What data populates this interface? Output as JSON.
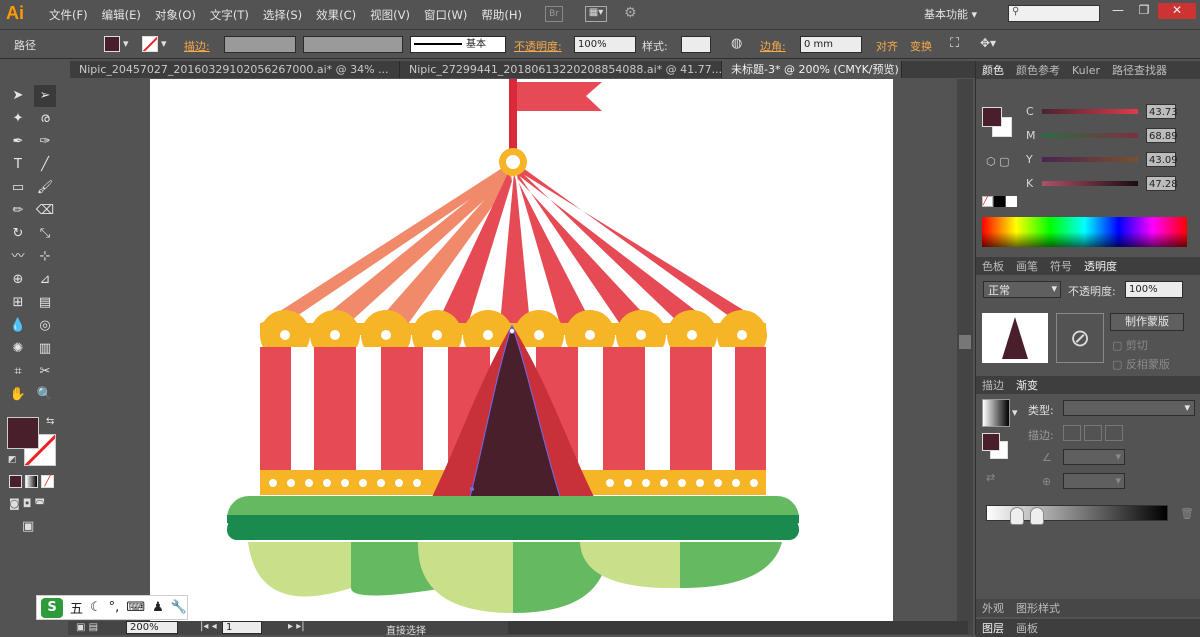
{
  "app": {
    "logo": "Ai",
    "menus": [
      "文件(F)",
      "编辑(E)",
      "对象(O)",
      "文字(T)",
      "选择(S)",
      "效果(C)",
      "视图(V)",
      "窗口(W)",
      "帮助(H)"
    ],
    "br_badge": "Br",
    "workspace": "基本功能",
    "window_controls": [
      "—",
      "❐",
      "✕"
    ]
  },
  "control": {
    "object_label": "路径",
    "stroke_label": "描边:",
    "stroke_style": "基本",
    "opacity_label": "不透明度:",
    "opacity_value": "100%",
    "style_label": "样式:",
    "corner_label": "边角:",
    "corner_value": "0 mm",
    "align": "对齐",
    "transform": "变换"
  },
  "doc_tabs": [
    {
      "label": "Nipic_20457027_20160329102056267000.ai* @ 34% ..."
    },
    {
      "label": "Nipic_27299441_20180613220208854088.ai* @ 41.77..."
    },
    {
      "label": "未标题-3* @ 200% (CMYK/预览)"
    }
  ],
  "status": {
    "zoom": "200%",
    "page": "1",
    "tool": "直接选择"
  },
  "color_panel": {
    "tabs": [
      "颜色",
      "颜色参考",
      "Kuler",
      "路径查找器"
    ],
    "channels": [
      {
        "name": "C",
        "value": "43.73"
      },
      {
        "name": "M",
        "value": "68.89"
      },
      {
        "name": "Y",
        "value": "43.09"
      },
      {
        "name": "K",
        "value": "47.28"
      }
    ]
  },
  "transparency_panel": {
    "tabs": [
      "色板",
      "画笔",
      "符号",
      "透明度"
    ],
    "mode": "正常",
    "opacity_label": "不透明度:",
    "opacity_value": "100%",
    "make_mask": "制作蒙版",
    "clip": "剪切",
    "invert": "反相蒙版"
  },
  "gradient_panel": {
    "tabs": [
      "描边",
      "渐变"
    ],
    "type_label": "类型:",
    "stroke_label": "描边:"
  },
  "bottom_panels": {
    "row1": [
      "外观",
      "图形样式"
    ],
    "row2": [
      "图层",
      "画板"
    ]
  },
  "ime": {
    "mode": "五",
    "items": [
      "☾",
      "°,",
      "⌨",
      "♟",
      "🔧"
    ]
  },
  "colors": {
    "fill": "#4a1f2c",
    "tent_red": "#e64a55",
    "tent_light": "#f08a6b",
    "gold": "#f5b527",
    "green": "#65b960",
    "dark_green": "#1a8a4f",
    "pale_green": "#c8e08a"
  }
}
